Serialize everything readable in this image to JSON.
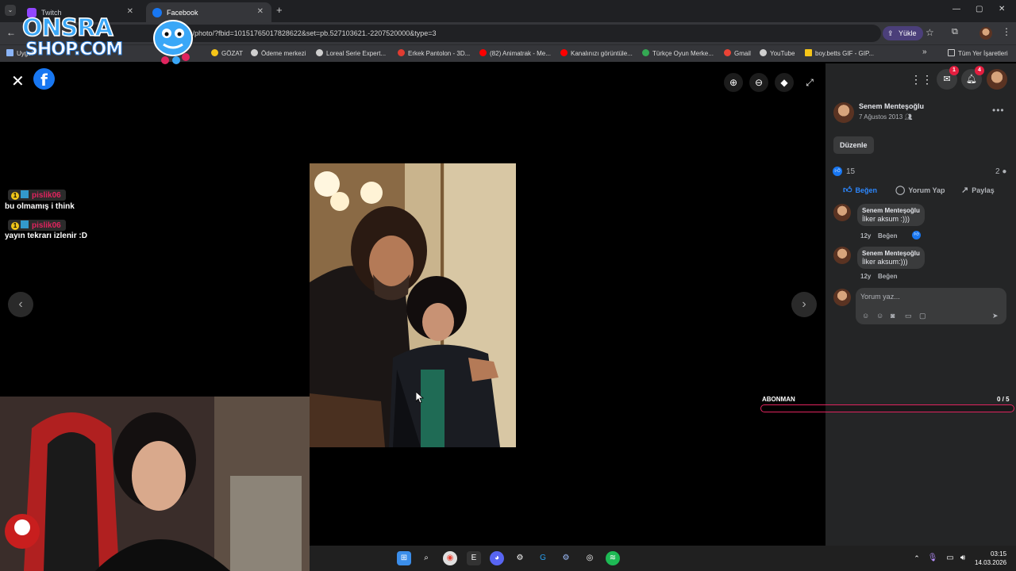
{
  "browser": {
    "tabs": [
      {
        "label": "Twitch",
        "color": "#9146ff"
      },
      {
        "label": "Facebook",
        "color": "#1877f2"
      }
    ],
    "url": "om/photo/?fbid=10151765017828622&set=pb.527103621.-2207520000&type=3",
    "yukle_label": "Yükle",
    "bookmarks": [
      {
        "label": "Uygul",
        "color": "#8ab4f8"
      },
      {
        "label": "GÖZAT",
        "color": "#f5c518"
      },
      {
        "label": "Ödeme merkezi",
        "color": "#cfcfcf"
      },
      {
        "label": "Loreal Serie Expert...",
        "color": "#cfcfcf"
      },
      {
        "label": "Erkek Pantolon - 3D...",
        "color": "#e03c31"
      },
      {
        "label": "(82) Animatrak - Me...",
        "color": "#ff0000"
      },
      {
        "label": "Kanalınızı görüntüle...",
        "color": "#ff0000"
      },
      {
        "label": "Türkçe Oyun Merke...",
        "color": "#34a853"
      },
      {
        "label": "Gmail",
        "color": "#ea4335"
      },
      {
        "label": "YouTube",
        "color": "#cfcfcf"
      },
      {
        "label": "boy.betts GIF - GIP...",
        "color": "#f5c518"
      },
      {
        "label": "Tüm Yer İşaretleri",
        "color": "#cfcfcf"
      }
    ]
  },
  "overlay": {
    "logo_line1": "ONSRA",
    "logo_line2": "SHOP.COM",
    "chat": [
      {
        "user": "pislik06",
        "message": "bu olmamış i think"
      },
      {
        "user": "pislik06",
        "message": "yayın tekrarı izlenir :D"
      }
    ],
    "abonman": {
      "label": "ABONMAN",
      "count_text": "0 / 5",
      "progress": 0
    }
  },
  "viewer": {
    "close_icon": "close-icon",
    "prev_icon": "chevron-left-icon",
    "next_icon": "chevron-right-icon"
  },
  "panel": {
    "messenger_badge": "1",
    "notifications_badge": "4",
    "post": {
      "author": "Senem Menteşoğlu",
      "date": "7 Ağustos 2013",
      "edit_label": "Düzenle",
      "likes": "15",
      "comments": "2"
    },
    "actions": {
      "like": "Beğen",
      "comment": "Yorum Yap",
      "share": "Paylaş"
    },
    "comments": [
      {
        "name": "Senem Menteşoğlu",
        "text": "İlker aksum :)))",
        "age": "12y",
        "like": "Beğen"
      },
      {
        "name": "Senem Menteşoğlu",
        "text": "İlker aksum:)))",
        "age": "12y",
        "like": "Beğen"
      }
    ],
    "composer_placeholder": "Yorum yaz..."
  },
  "system": {
    "time": "03:15",
    "date": "14.03.2026"
  },
  "colors": {
    "facebook_blue": "#1877f2",
    "panel_bg": "#242526",
    "stream_accent": "#e0245e"
  }
}
